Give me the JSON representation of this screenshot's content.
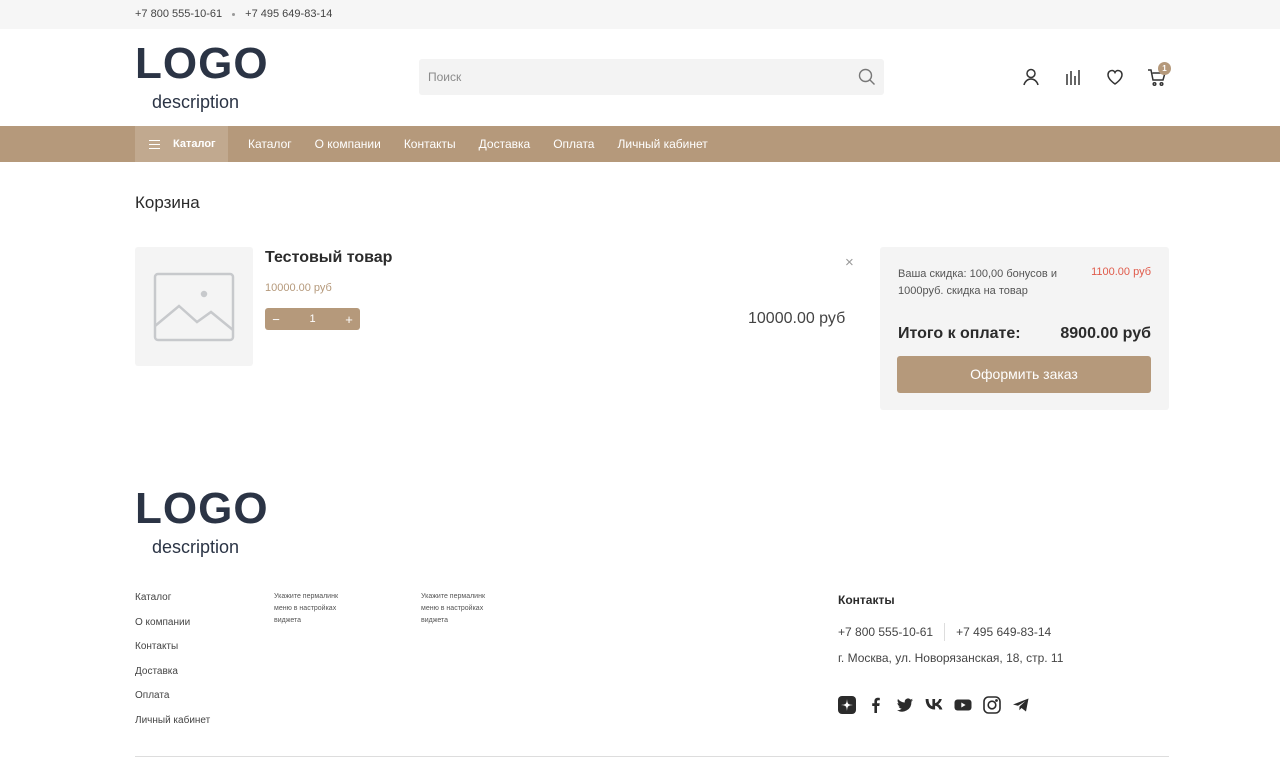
{
  "topbar": {
    "phone1": "+7 800 555-10-61",
    "phone2": "+7 495 649-83-14"
  },
  "logo": {
    "main": "LOGO",
    "desc": "description"
  },
  "search": {
    "placeholder": "Поиск"
  },
  "header_icons": [
    "user-icon",
    "compare-icon",
    "heart-icon",
    "cart-icon"
  ],
  "cart_count": "1",
  "nav": {
    "catalog_button": "Каталог",
    "items": [
      "Каталог",
      "О компании",
      "Контакты",
      "Доставка",
      "Оплата",
      "Личный кабинет"
    ]
  },
  "page_title": "Корзина",
  "cart_item": {
    "name": "Тестовый товар",
    "price": "10000.00 руб",
    "quantity": "1",
    "total": "10000.00 руб",
    "remove": "×"
  },
  "summary": {
    "discount_text": "Ваша скидка: 100,00 бонусов и 1000руб. скидка на товар",
    "discount_value": "1100.00 руб",
    "total_label": "Итого к оплате:",
    "total_value": "8900.00 руб",
    "order_button": "Оформить заказ"
  },
  "footer": {
    "menu": [
      "Каталог",
      "О компании",
      "Контакты",
      "Доставка",
      "Оплата",
      "Личный кабинет"
    ],
    "note1": "Укажите пермалинк меню в настройках виджета",
    "note2": "Укажите пермалинк меню в настройках виджета",
    "contacts_title": "Контакты",
    "phone1": "+7 800 555-10-61",
    "phone2": "+7 495 649-83-14",
    "address": "г. Москва, ул. Новорязанская, 18, стр. 11",
    "socials": [
      "yandex-zen-icon",
      "facebook-icon",
      "twitter-icon",
      "vk-icon",
      "youtube-icon",
      "instagram-icon",
      "telegram-icon"
    ]
  },
  "colors": {
    "accent": "#b5997b",
    "discount": "#e05b4b",
    "logo": "#2b3445"
  }
}
